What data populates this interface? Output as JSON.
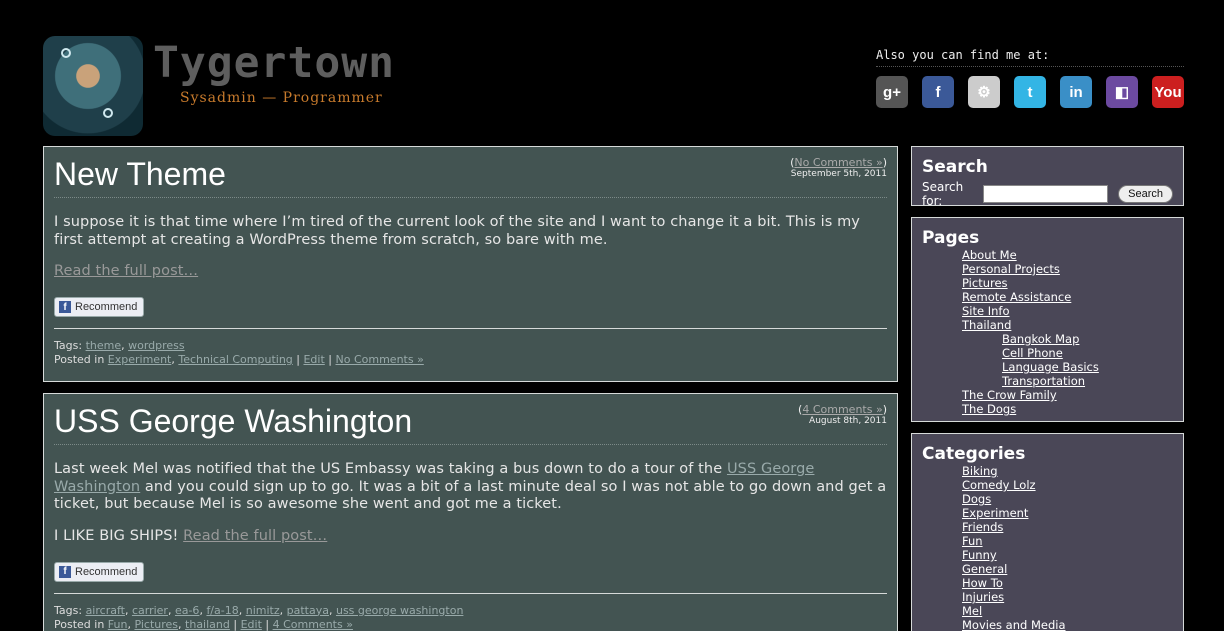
{
  "header": {
    "title": "Tygertown",
    "tagline": "Sysadmin — Programmer",
    "findme_label": "Also you can find me at:",
    "social": [
      {
        "name": "google-plus",
        "glyph": "g+",
        "color": "#555555"
      },
      {
        "name": "facebook",
        "glyph": "f",
        "color": "#3b5998"
      },
      {
        "name": "github",
        "glyph": "⚙",
        "color": "#cccccc"
      },
      {
        "name": "twitter",
        "glyph": "t",
        "color": "#33b5e5"
      },
      {
        "name": "linkedin",
        "glyph": "in",
        "color": "#3a8fc7"
      },
      {
        "name": "picasa",
        "glyph": "◧",
        "color": "#6c4aa0"
      },
      {
        "name": "youtube",
        "glyph": "You",
        "color": "#cc1f1f"
      }
    ]
  },
  "posts": [
    {
      "title": "New Theme",
      "comments_link": "No Comments »",
      "date": "September 5th, 2011",
      "body": "I suppose it is that time where I’m tired of the current look of the site and I want to change it a bit. This is my first attempt at creating a WordPress theme from scratch, so bare with me.",
      "read_more": "Read the full post…",
      "recommend": "Recommend",
      "tags_label": "Tags:",
      "tags": [
        "theme",
        "wordpress"
      ],
      "posted_label": "Posted in",
      "categories": [
        "Experiment",
        "Technical Computing"
      ],
      "edit": "Edit",
      "foot_comments": "No Comments »"
    },
    {
      "title": "USS George Washington",
      "comments_link": "4 Comments »",
      "date": "August 8th, 2011",
      "body_before": "Last week Mel was notified that the US Embassy was taking a bus down to do a tour of the ",
      "body_link": "USS George Washington",
      "body_after": " and you could sign up to go. It was a bit of a last minute deal so I was not able to go down and get a ticket, but because Mel is so awesome she went and got me a ticket.",
      "body2": "I LIKE BIG SHIPS!",
      "read_more": "Read the full post…",
      "recommend": "Recommend",
      "tags_label": "Tags:",
      "tags": [
        "aircraft",
        "carrier",
        "ea-6",
        "f/a-18",
        "nimitz",
        "pattaya",
        "uss george washington"
      ],
      "posted_label": "Posted in",
      "categories": [
        "Fun",
        "Pictures",
        "thailand"
      ],
      "edit": "Edit",
      "foot_comments": "4 Comments »"
    }
  ],
  "sidebar": {
    "search": {
      "title": "Search",
      "label": "Search for:",
      "value": "",
      "button": "Search"
    },
    "pages": {
      "title": "Pages",
      "items": [
        {
          "label": "About Me",
          "level": 0
        },
        {
          "label": "Personal Projects",
          "level": 0
        },
        {
          "label": "Pictures",
          "level": 0
        },
        {
          "label": "Remote Assistance",
          "level": 0
        },
        {
          "label": "Site Info",
          "level": 0
        },
        {
          "label": "Thailand",
          "level": 0
        },
        {
          "label": "Bangkok Map",
          "level": 1
        },
        {
          "label": "Cell Phone",
          "level": 1
        },
        {
          "label": "Language Basics",
          "level": 1
        },
        {
          "label": "Transportation",
          "level": 1
        },
        {
          "label": "The Crow Family",
          "level": 0
        },
        {
          "label": "The Dogs",
          "level": 0
        }
      ]
    },
    "categories": {
      "title": "Categories",
      "items": [
        "Biking",
        "Comedy Lolz",
        "Dogs",
        "Experiment",
        "Friends",
        "Fun",
        "Funny",
        "General",
        "How To",
        "Injuries",
        "Mel",
        "Movies and Media"
      ]
    }
  }
}
